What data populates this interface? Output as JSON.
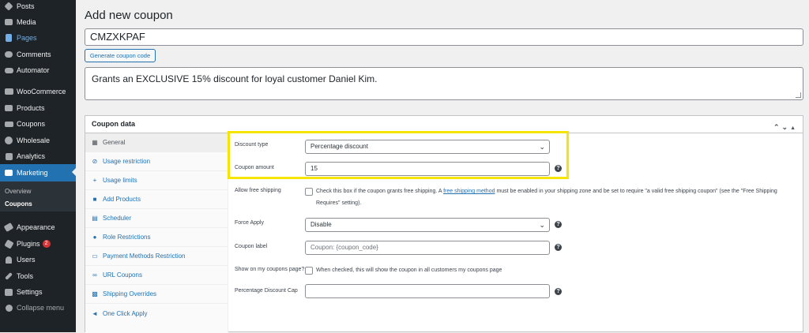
{
  "sidebar": {
    "items": [
      {
        "label": "Posts",
        "icon": "pin-icon"
      },
      {
        "label": "Media",
        "icon": "media-icon"
      },
      {
        "label": "Pages",
        "icon": "pages-icon"
      },
      {
        "label": "Comments",
        "icon": "comments-icon"
      },
      {
        "label": "Automator",
        "icon": "automator-icon"
      },
      {
        "label": "WooCommerce",
        "icon": "woo-icon"
      },
      {
        "label": "Products",
        "icon": "products-icon"
      },
      {
        "label": "Coupons",
        "icon": "coupons-icon"
      },
      {
        "label": "Wholesale",
        "icon": "wholesale-icon"
      },
      {
        "label": "Analytics",
        "icon": "analytics-icon"
      },
      {
        "label": "Marketing",
        "icon": "marketing-icon"
      },
      {
        "label": "Appearance",
        "icon": "appearance-icon"
      },
      {
        "label": "Plugins",
        "icon": "plugins-icon",
        "badge": "2"
      },
      {
        "label": "Users",
        "icon": "users-icon"
      },
      {
        "label": "Tools",
        "icon": "tools-icon"
      },
      {
        "label": "Settings",
        "icon": "settings-icon"
      },
      {
        "label": "Collapse menu",
        "icon": "collapse-icon"
      }
    ],
    "submenu": [
      "Overview",
      "Coupons"
    ]
  },
  "page": {
    "title": "Add new coupon",
    "coupon_code": "CMZXKPAF",
    "generate_label": "Generate coupon code",
    "description": "Grants an EXCLUSIVE 15% discount for loyal customer Daniel Kim."
  },
  "coupon_data": {
    "heading": "Coupon data",
    "tabs": [
      {
        "label": "General",
        "icon": "general-icon"
      },
      {
        "label": "Usage restriction",
        "icon": "restriction-icon"
      },
      {
        "label": "Usage limits",
        "icon": "limits-icon"
      },
      {
        "label": "Add Products",
        "icon": "add-products-icon"
      },
      {
        "label": "Scheduler",
        "icon": "scheduler-icon"
      },
      {
        "label": "Role Restrictions",
        "icon": "role-icon"
      },
      {
        "label": "Payment Methods Restriction",
        "icon": "payment-icon"
      },
      {
        "label": "URL Coupons",
        "icon": "url-icon"
      },
      {
        "label": "Shipping Overrides",
        "icon": "shipping-icon"
      },
      {
        "label": "One Click Apply",
        "icon": "one-click-icon"
      }
    ],
    "fields": {
      "discount_type_label": "Discount type",
      "discount_type_value": "Percentage discount",
      "coupon_amount_label": "Coupon amount",
      "coupon_amount_value": "15",
      "free_shipping_label": "Allow free shipping",
      "free_shipping_text_pre": "Check this box if the coupon grants free shipping. A ",
      "free_shipping_link": "free shipping method",
      "free_shipping_text_post": " must be enabled in your shipping zone and be set to require \"a valid free shipping coupon\" (see the \"Free Shipping Requires\" setting).",
      "force_apply_label": "Force Apply",
      "force_apply_value": "Disable",
      "coupon_label_label": "Coupon label",
      "coupon_label_placeholder": "Coupon: {coupon_code}",
      "show_label": "Show on my coupons page?",
      "show_text": "When checked, this will show the coupon in all customers my coupons page",
      "pct_cap_label": "Percentage Discount Cap",
      "pct_cap_value": ""
    }
  },
  "colors": {
    "accent": "#2271b1",
    "highlight": "#f6e500",
    "sidebar": "#1d2327"
  }
}
